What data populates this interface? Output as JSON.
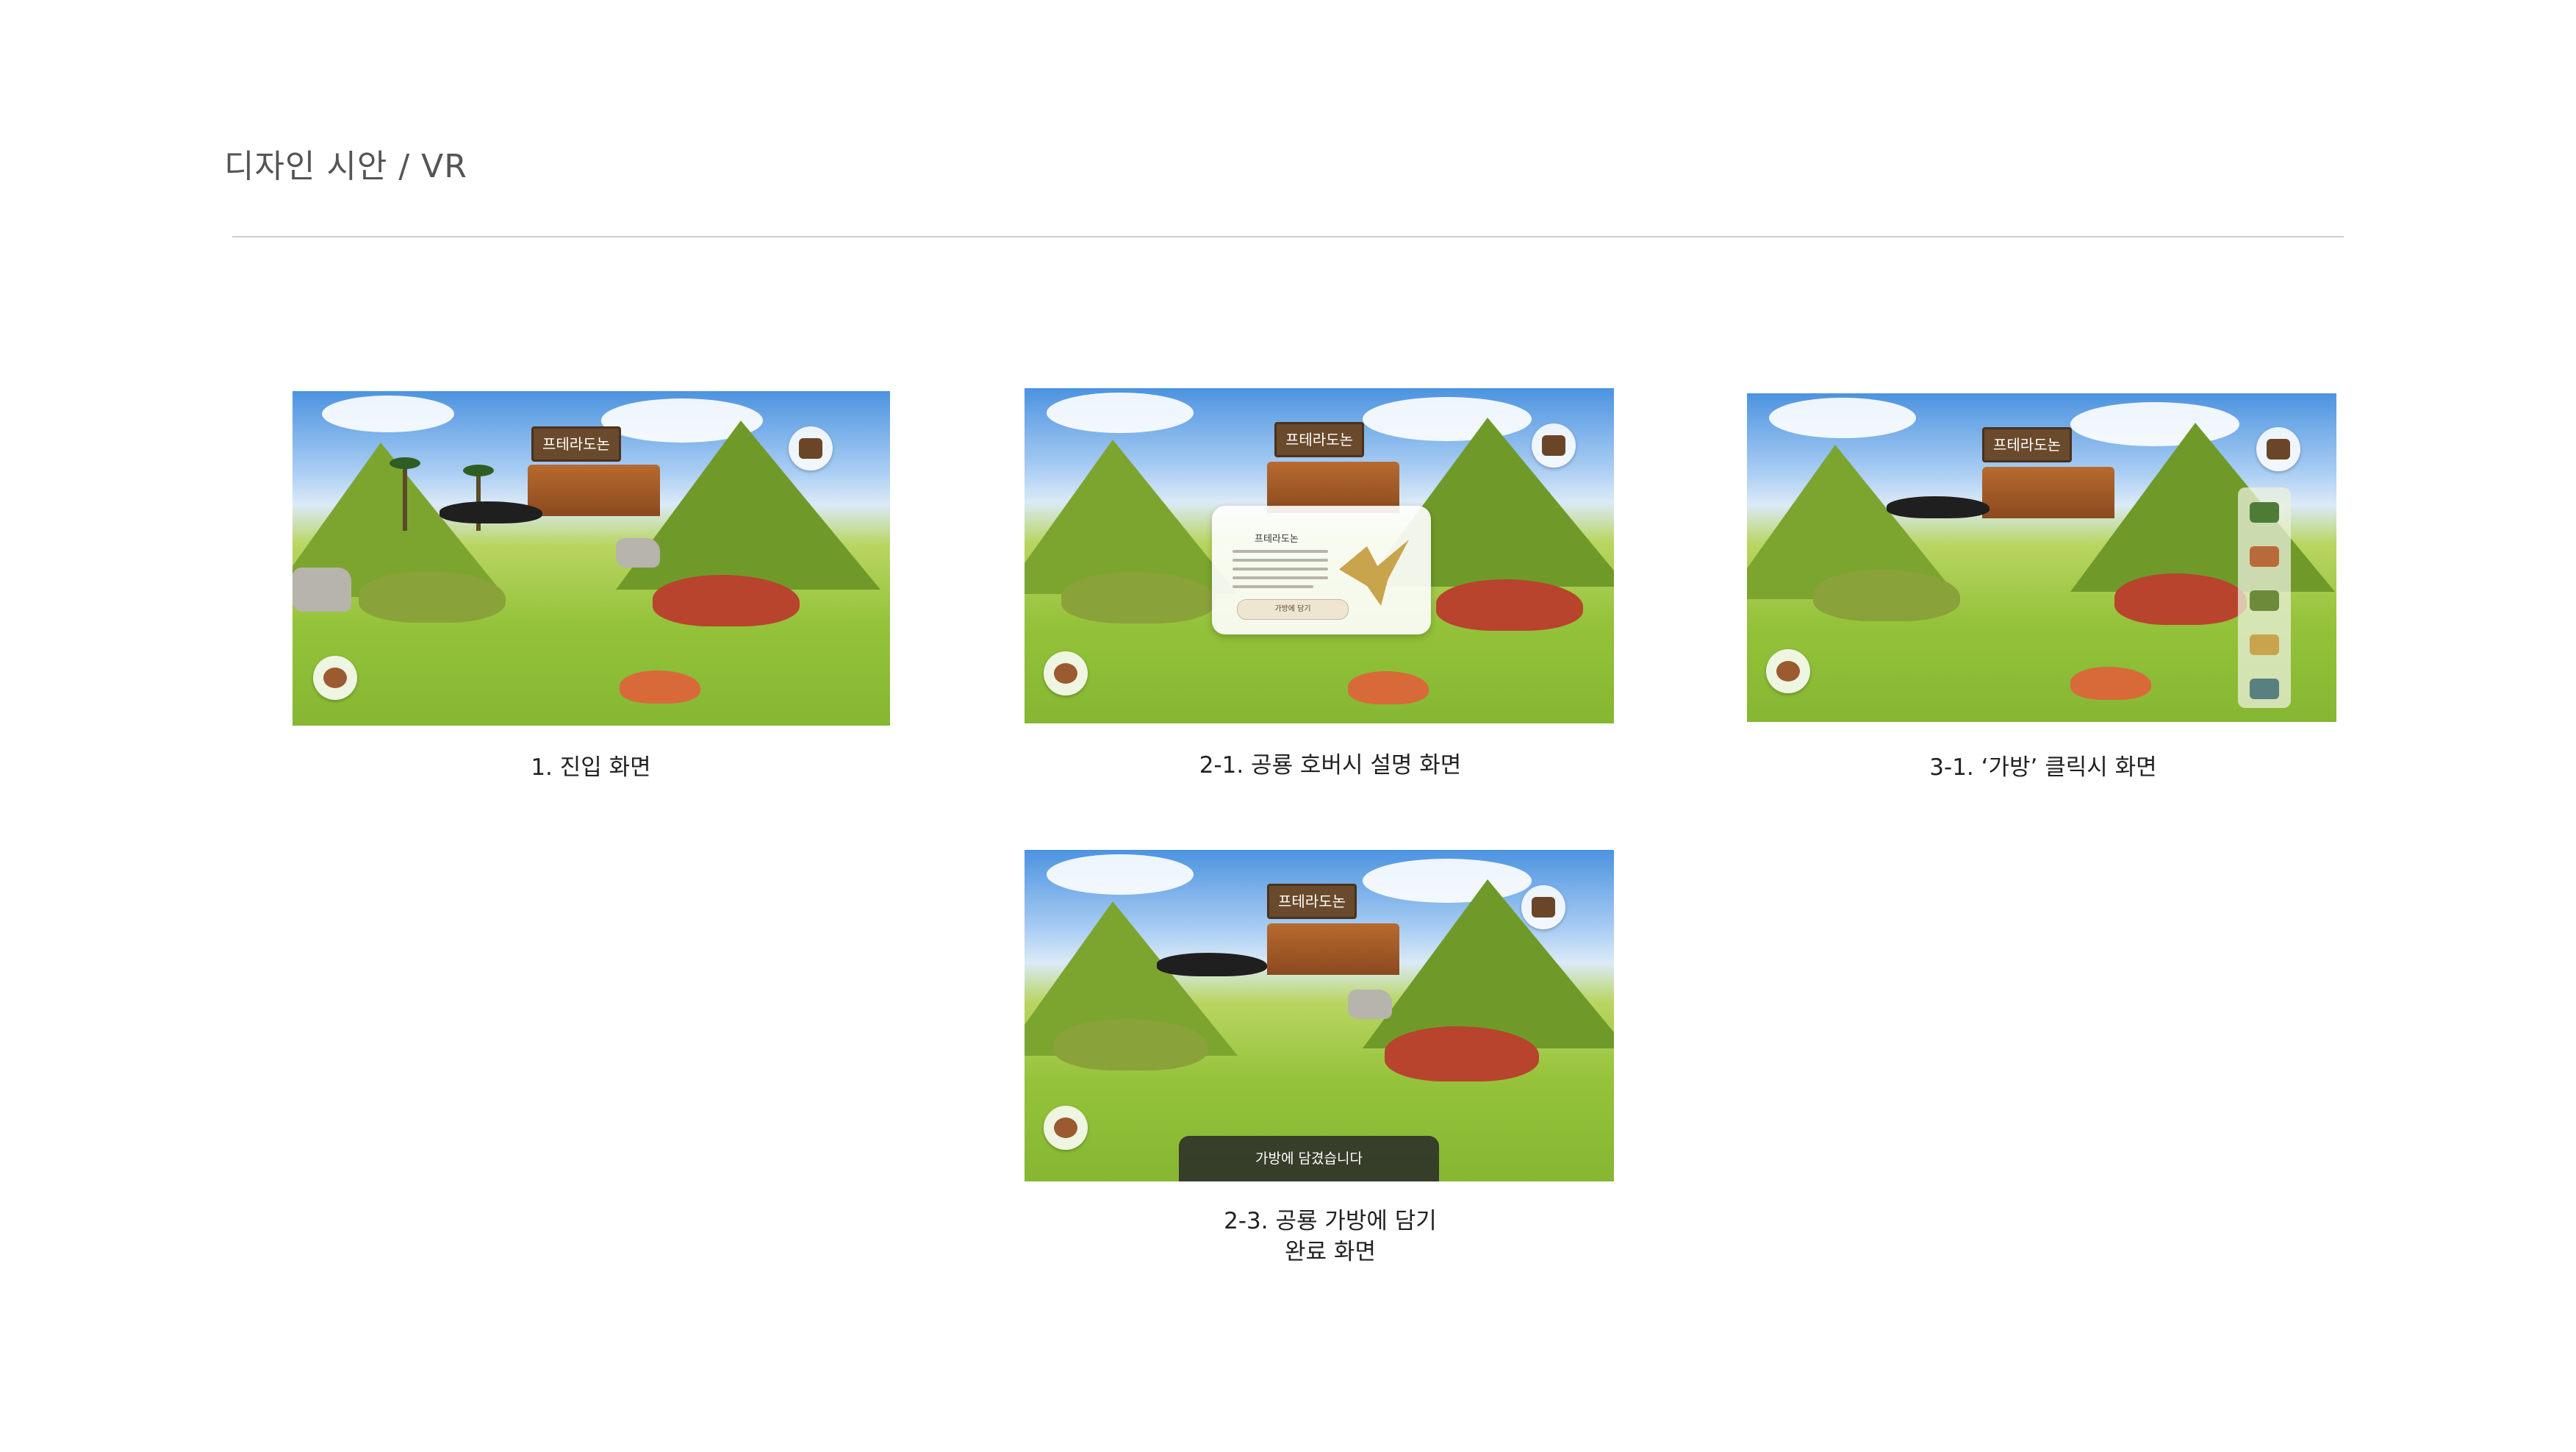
{
  "page": {
    "title": "디자인 시안 / VR"
  },
  "screens": [
    {
      "caption": "1. 진입 화면",
      "sign_label": "프테라도논"
    },
    {
      "caption": "2-1. 공룡 호버시 설명 화면",
      "sign_label": "프테라도논",
      "info_panel": {
        "title": "프테라도논",
        "button_label": "가방에 담기"
      }
    },
    {
      "caption": "3-1. ‘가방’ 클릭시 화면",
      "sign_label": "프테라도논"
    },
    {
      "caption": "2-3. 공룡 가방에 담기\n완료 화면",
      "sign_label": "프테라도논",
      "toast_text": "가방에 담겼습니다"
    }
  ],
  "icons": {
    "bag": "backpack-icon",
    "dino_collection": "dinosaur-collection-icon"
  },
  "colors": {
    "title_text": "#555555",
    "divider": "#cfcfcf",
    "sign_bg": "#6a4a2c",
    "grass": "#94c23a",
    "sky": "#4c93e0"
  }
}
